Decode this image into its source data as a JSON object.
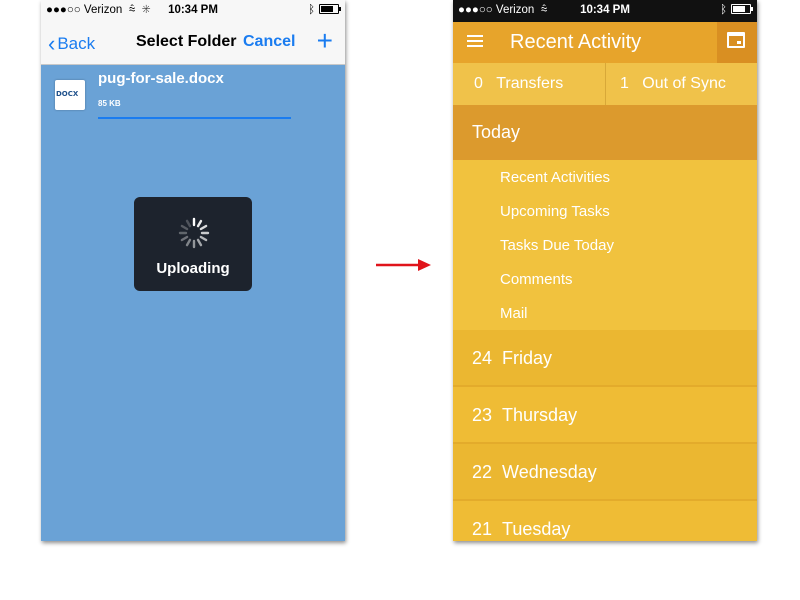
{
  "left_screen": {
    "status_bar": {
      "carrier": "●●●○○ Verizon",
      "time": "10:34 PM"
    },
    "nav": {
      "back_label": "Back",
      "title": "Select Folder",
      "cancel_label": "Cancel",
      "add_label": "+"
    },
    "file": {
      "type_badge": "DOCX",
      "name": "pug-for-sale.docx",
      "size": "85 KB",
      "progress": 1.0
    },
    "upload_overlay": {
      "label": "Uploading"
    }
  },
  "right_screen": {
    "status_bar": {
      "carrier": "●●●○○ Verizon",
      "time": "10:34 PM"
    },
    "header": {
      "title": "Recent Activity"
    },
    "stats": {
      "transfers_count": "0",
      "transfers_label": "Transfers",
      "out_of_sync_count": "1",
      "out_of_sync_label": "Out of Sync"
    },
    "today": {
      "label": "Today"
    },
    "today_items": [
      "Recent Activities",
      "Upcoming Tasks",
      "Tasks Due Today",
      "Comments",
      "Mail"
    ],
    "days": [
      {
        "date": "24",
        "day": "Friday"
      },
      {
        "date": "23",
        "day": "Thursday"
      },
      {
        "date": "22",
        "day": "Wednesday"
      },
      {
        "date": "21",
        "day": "Tuesday"
      }
    ]
  },
  "colors": {
    "ios_blue": "#1a7cf0",
    "left_background": "#6aa2d6",
    "accent_orange": "#e7a42b",
    "accent_yellow": "#f1c23e",
    "arrow_red": "#e0141b"
  }
}
